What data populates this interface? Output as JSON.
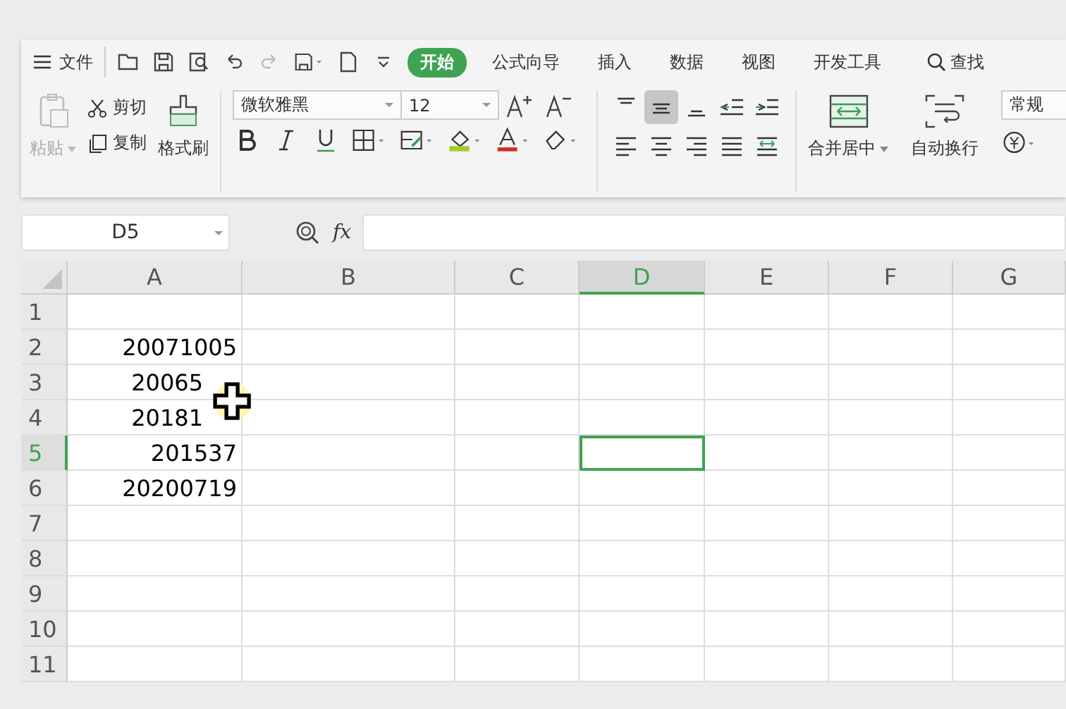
{
  "menu": {
    "file": "文件"
  },
  "tabs": [
    {
      "label": "开始",
      "selected": true
    },
    {
      "label": "公式向导",
      "selected": false
    },
    {
      "label": "插入",
      "selected": false
    },
    {
      "label": "数据",
      "selected": false
    },
    {
      "label": "视图",
      "selected": false
    },
    {
      "label": "开发工具",
      "selected": false
    }
  ],
  "search": "查找",
  "ribbon": {
    "paste": {
      "label": "粘贴",
      "disabled": true
    },
    "cut": "剪切",
    "copy": "复制",
    "format_painter": "格式刷",
    "font_name": "微软雅黑",
    "font_size": "12",
    "merge": "合并居中",
    "wrap": "自动换行",
    "number_format": "常规",
    "vertical_align": [
      {
        "selected": false
      },
      {
        "selected": true
      },
      {
        "selected": false
      }
    ]
  },
  "formula_bar": {
    "cell_ref": "D5",
    "fx": "fx"
  },
  "columns": [
    {
      "label": "A",
      "selected": false
    },
    {
      "label": "B",
      "selected": false
    },
    {
      "label": "C",
      "selected": false
    },
    {
      "label": "D",
      "selected": true
    },
    {
      "label": "E",
      "selected": false
    },
    {
      "label": "F",
      "selected": false
    },
    {
      "label": "G",
      "selected": false
    }
  ],
  "rows": [
    {
      "label": "1",
      "selected": false
    },
    {
      "label": "2",
      "selected": false,
      "a": "20071005"
    },
    {
      "label": "3",
      "selected": false,
      "a": "20065",
      "covered": true
    },
    {
      "label": "4",
      "selected": false,
      "a": "20181",
      "covered": true
    },
    {
      "label": "5",
      "selected": true,
      "a": "201537"
    },
    {
      "label": "6",
      "selected": false,
      "a": "20200719"
    },
    {
      "label": "7",
      "selected": false
    },
    {
      "label": "8",
      "selected": false
    },
    {
      "label": "9",
      "selected": false
    },
    {
      "label": "10",
      "selected": false
    },
    {
      "label": "11",
      "selected": false
    }
  ]
}
